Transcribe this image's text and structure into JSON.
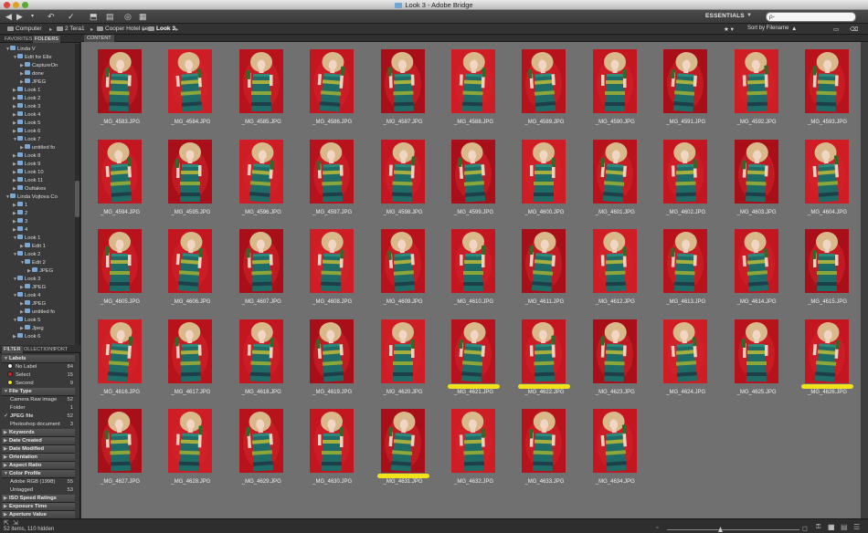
{
  "window": {
    "title": "Look 3 - Adobe Bridge"
  },
  "toolbar": {
    "workspace": "ESSENTIALS",
    "search_placeholder": "ρ-"
  },
  "pathbar": {
    "crumbs": [
      "Computer",
      "2 Tera1",
      "Cooper Hotel new",
      "Look 3"
    ],
    "sort_label": "Sort by Filename"
  },
  "panels": {
    "top_tabs": [
      "FAVORITES",
      "FOLDERS"
    ],
    "content_tab": "CONTENT",
    "filter_tabs": [
      "FILTER",
      "OLLECTIONS",
      "PORT"
    ]
  },
  "folders": [
    {
      "label": "Linda V",
      "indent": 2,
      "open": true
    },
    {
      "label": "Edit for Elle",
      "indent": 3,
      "open": true
    },
    {
      "label": "CaptureOn",
      "indent": 4,
      "open": false
    },
    {
      "label": "done",
      "indent": 4,
      "open": false
    },
    {
      "label": "JPEG",
      "indent": 4,
      "open": false
    },
    {
      "label": "Look 1",
      "indent": 3,
      "open": false
    },
    {
      "label": "Look 2",
      "indent": 3,
      "open": false
    },
    {
      "label": "Look 3",
      "indent": 3,
      "open": false
    },
    {
      "label": "Look 4",
      "indent": 3,
      "open": false
    },
    {
      "label": "Look 5",
      "indent": 3,
      "open": false
    },
    {
      "label": "Look 6",
      "indent": 3,
      "open": false
    },
    {
      "label": "Look 7",
      "indent": 3,
      "open": true
    },
    {
      "label": "untitled fo",
      "indent": 4,
      "open": false
    },
    {
      "label": "Look 8",
      "indent": 3,
      "open": false
    },
    {
      "label": "Look 9",
      "indent": 3,
      "open": false
    },
    {
      "label": "Look 10",
      "indent": 3,
      "open": false
    },
    {
      "label": "Look 11",
      "indent": 3,
      "open": false
    },
    {
      "label": "Outtakes",
      "indent": 3,
      "open": false
    },
    {
      "label": "Linda Vojtova Co",
      "indent": 2,
      "open": true
    },
    {
      "label": "1",
      "indent": 3,
      "open": false
    },
    {
      "label": "2",
      "indent": 3,
      "open": false
    },
    {
      "label": "3",
      "indent": 3,
      "open": false
    },
    {
      "label": "4",
      "indent": 3,
      "open": false
    },
    {
      "label": "Look 1",
      "indent": 3,
      "open": true
    },
    {
      "label": "Edit 1",
      "indent": 4,
      "open": false
    },
    {
      "label": "Look 2",
      "indent": 3,
      "open": true
    },
    {
      "label": "Edit 2",
      "indent": 4,
      "open": true
    },
    {
      "label": "JPEG",
      "indent": 5,
      "open": false
    },
    {
      "label": "Look 3",
      "indent": 3,
      "open": true
    },
    {
      "label": "JPEG",
      "indent": 4,
      "open": false
    },
    {
      "label": "Look 4",
      "indent": 3,
      "open": true
    },
    {
      "label": "JPEG",
      "indent": 4,
      "open": false
    },
    {
      "label": "untitled fo",
      "indent": 4,
      "open": false
    },
    {
      "label": "Look 5",
      "indent": 3,
      "open": true
    },
    {
      "label": "Jpeg",
      "indent": 4,
      "open": false
    },
    {
      "label": "Look 6",
      "indent": 3,
      "open": false
    }
  ],
  "filter": {
    "labels_head": "Labels",
    "labels": [
      {
        "name": "No Label",
        "count": "84",
        "color": "#f0f0f0"
      },
      {
        "name": "Select",
        "count": "15",
        "color": "#c8262b"
      },
      {
        "name": "Second",
        "count": "9",
        "color": "#f2e21a"
      }
    ],
    "filetype_head": "File Type",
    "filetypes": [
      {
        "name": "Camera Raw image",
        "count": "52",
        "checked": false
      },
      {
        "name": "Folder",
        "count": "1",
        "checked": false
      },
      {
        "name": "JPEG file",
        "count": "52",
        "checked": true
      },
      {
        "name": "Photoshop document",
        "count": "3",
        "checked": false
      }
    ],
    "collapsed_heads_1": [
      "Keywords",
      "Date Created",
      "Date Modified",
      "Orientation",
      "Aspect Ratio"
    ],
    "colorprofile_head": "Color Profile",
    "colorprofiles": [
      {
        "name": "Adobe RGB (1998)",
        "count": "55"
      },
      {
        "name": "Untagged",
        "count": "53"
      }
    ],
    "collapsed_heads_2": [
      "ISO Speed Ratings",
      "Exposure Time",
      "Aperture Value"
    ]
  },
  "thumbnails": [
    {
      "name": "_MG_4583.JPG",
      "hl": false
    },
    {
      "name": "_MG_4584.JPG",
      "hl": false
    },
    {
      "name": "_MG_4585.JPG",
      "hl": false
    },
    {
      "name": "_MG_4586.JPG",
      "hl": false
    },
    {
      "name": "_MG_4587.JPG",
      "hl": false
    },
    {
      "name": "_MG_4588.JPG",
      "hl": false
    },
    {
      "name": "_MG_4589.JPG",
      "hl": false
    },
    {
      "name": "_MG_4590.JPG",
      "hl": false
    },
    {
      "name": "_MG_4591.JPG",
      "hl": false
    },
    {
      "name": "_MG_4592.JPG",
      "hl": false
    },
    {
      "name": "_MG_4593.JPG",
      "hl": false
    },
    {
      "name": "_MG_4594.JPG",
      "hl": false
    },
    {
      "name": "_MG_4595.JPG",
      "hl": false
    },
    {
      "name": "_MG_4596.JPG",
      "hl": false
    },
    {
      "name": "_MG_4597.JPG",
      "hl": false
    },
    {
      "name": "_MG_4598.JPG",
      "hl": false
    },
    {
      "name": "_MG_4599.JPG",
      "hl": false
    },
    {
      "name": "_MG_4600.JPG",
      "hl": false
    },
    {
      "name": "_MG_4601.JPG",
      "hl": false
    },
    {
      "name": "_MG_4602.JPG",
      "hl": false
    },
    {
      "name": "_MG_4603.JPG",
      "hl": false
    },
    {
      "name": "_MG_4604.JPG",
      "hl": false
    },
    {
      "name": "_MG_4605.JPG",
      "hl": false
    },
    {
      "name": "_MG_4606.JPG",
      "hl": false
    },
    {
      "name": "_MG_4607.JPG",
      "hl": false
    },
    {
      "name": "_MG_4608.JPG",
      "hl": false
    },
    {
      "name": "_MG_4609.JPG",
      "hl": false
    },
    {
      "name": "_MG_4610.JPG",
      "hl": false
    },
    {
      "name": "_MG_4611.JPG",
      "hl": false
    },
    {
      "name": "_MG_4612.JPG",
      "hl": false
    },
    {
      "name": "_MG_4613.JPG",
      "hl": false
    },
    {
      "name": "_MG_4614.JPG",
      "hl": false
    },
    {
      "name": "_MG_4615.JPG",
      "hl": false
    },
    {
      "name": "_MG_4616.JPG",
      "hl": false
    },
    {
      "name": "_MG_4617.JPG",
      "hl": false
    },
    {
      "name": "_MG_4618.JPG",
      "hl": false
    },
    {
      "name": "_MG_4619.JPG",
      "hl": false
    },
    {
      "name": "_MG_4620.JPG",
      "hl": false
    },
    {
      "name": "_MG_4621.JPG",
      "hl": true
    },
    {
      "name": "_MG_4622.JPG",
      "hl": true
    },
    {
      "name": "_MG_4623.JPG",
      "hl": false
    },
    {
      "name": "_MG_4624.JPG",
      "hl": false
    },
    {
      "name": "_MG_4625.JPG",
      "hl": false
    },
    {
      "name": "_MG_4626.JPG",
      "hl": true
    },
    {
      "name": "_MG_4627.JPG",
      "hl": false
    },
    {
      "name": "_MG_4628.JPG",
      "hl": false
    },
    {
      "name": "_MG_4629.JPG",
      "hl": false
    },
    {
      "name": "_MG_4630.JPG",
      "hl": false
    },
    {
      "name": "_MG_4631.JPG",
      "hl": true
    },
    {
      "name": "_MG_4632.JPG",
      "hl": false
    },
    {
      "name": "_MG_4633.JPG",
      "hl": false
    },
    {
      "name": "_MG_4634.JPG",
      "hl": false
    }
  ],
  "status": {
    "text": "52 items, 110 hidden"
  },
  "colors": {
    "highlight": "#f2e21a",
    "photo_red": "#c8161f",
    "content_bg": "#707070"
  }
}
